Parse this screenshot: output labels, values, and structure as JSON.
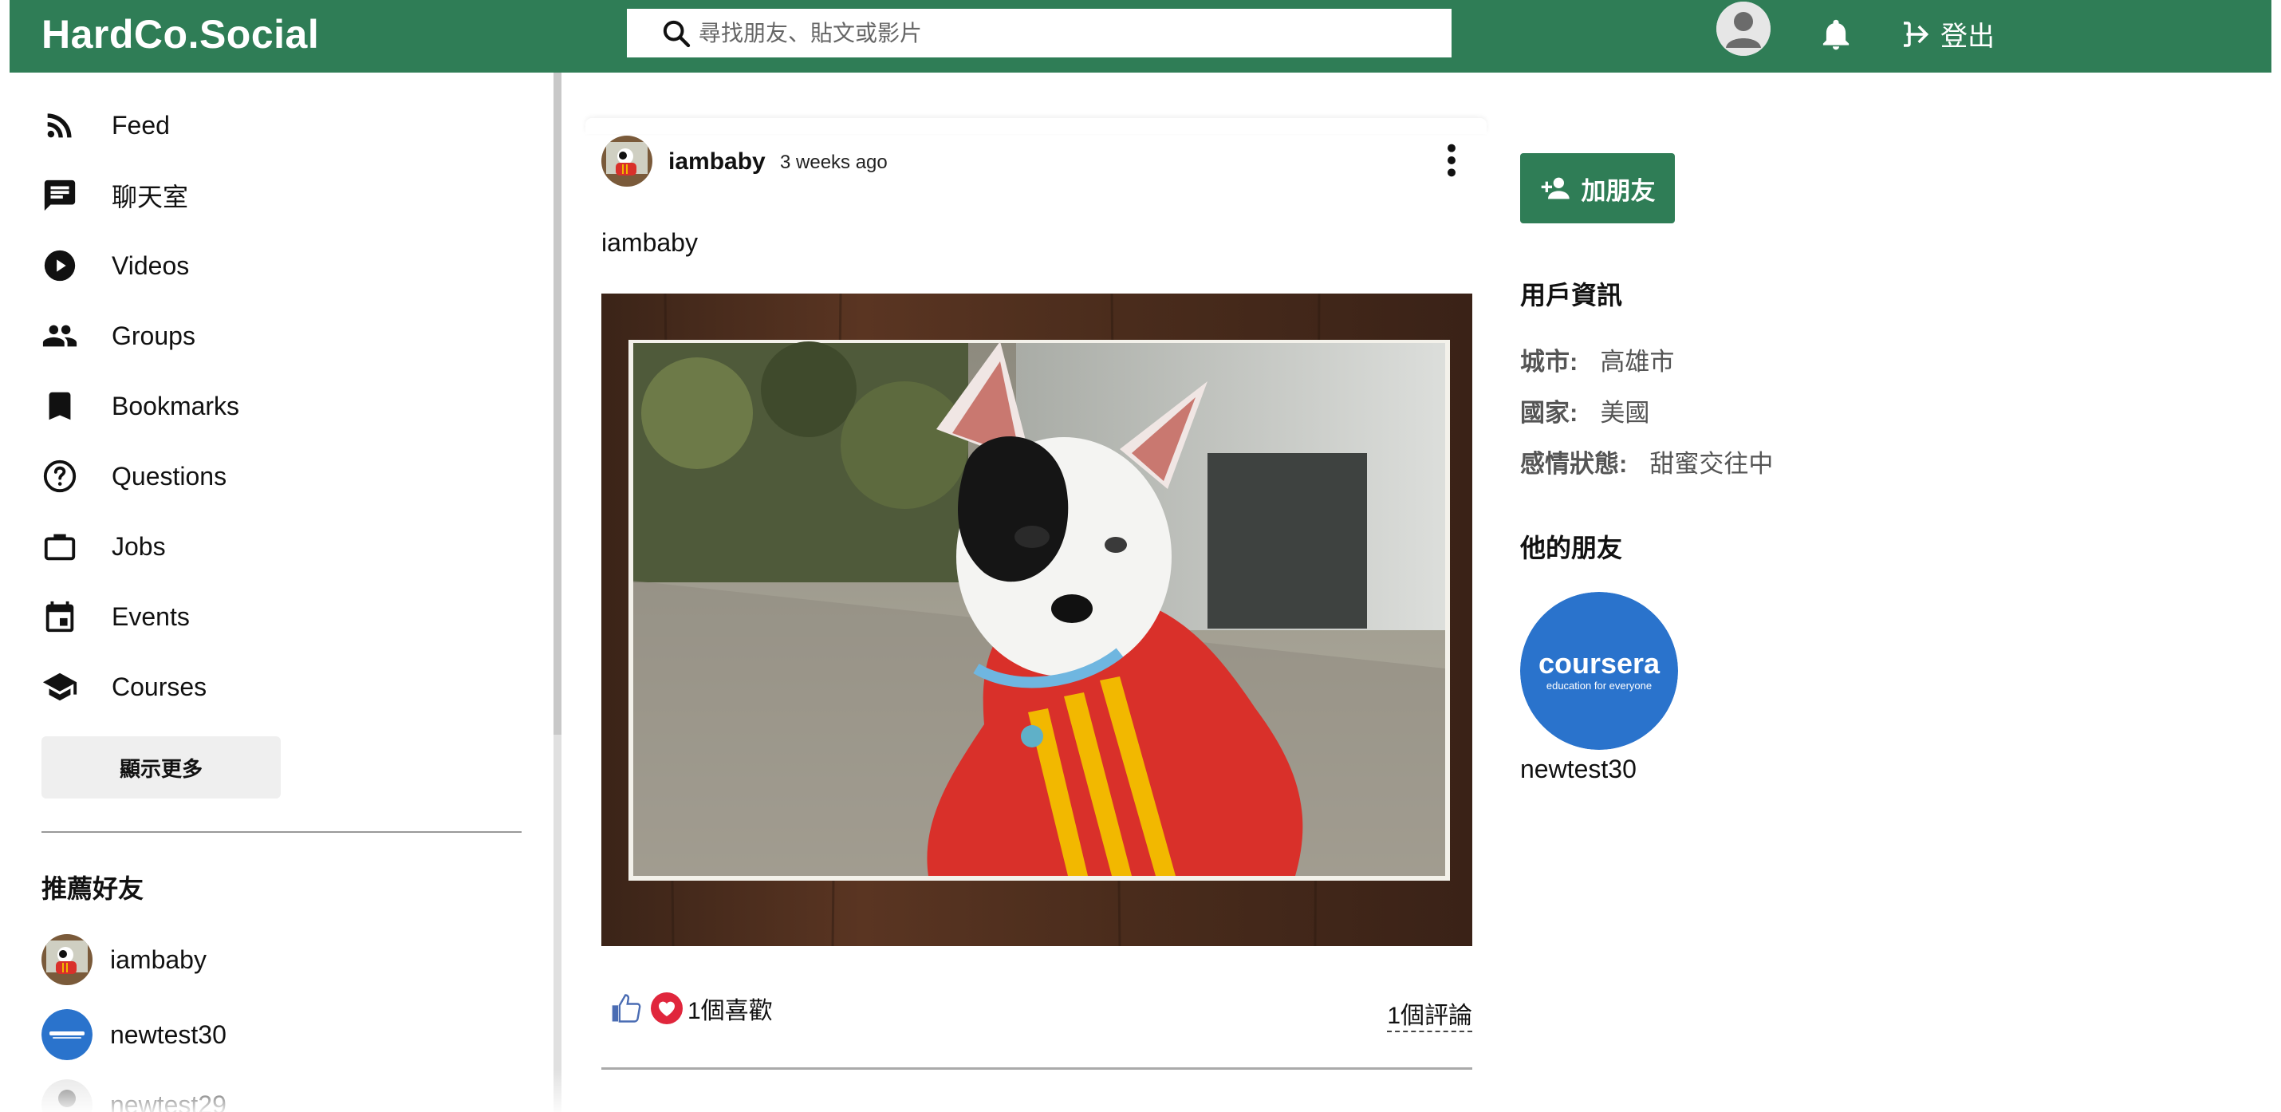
{
  "header": {
    "logo": "HardCo.Social",
    "search_placeholder": "尋找朋友、貼文或影片",
    "logout_label": "登出"
  },
  "sidebar": {
    "nav": [
      {
        "label": "Feed",
        "icon": "rss-icon"
      },
      {
        "label": "聊天室",
        "icon": "chat-icon"
      },
      {
        "label": "Videos",
        "icon": "play-circle-icon"
      },
      {
        "label": "Groups",
        "icon": "group-icon"
      },
      {
        "label": "Bookmarks",
        "icon": "bookmark-icon"
      },
      {
        "label": "Questions",
        "icon": "help-circle-icon"
      },
      {
        "label": "Jobs",
        "icon": "briefcase-icon"
      },
      {
        "label": "Events",
        "icon": "calendar-icon"
      },
      {
        "label": "Courses",
        "icon": "graduation-cap-icon"
      }
    ],
    "more_button": "顯示更多",
    "recommend_title": "推薦好友",
    "recommended": [
      {
        "name": "iambaby"
      },
      {
        "name": "newtest30"
      },
      {
        "name": "newtest29"
      }
    ]
  },
  "post": {
    "author": "iambaby",
    "time": "3 weeks ago",
    "text": "iambaby",
    "likes": "1個喜歡",
    "comments": "1個評論"
  },
  "profile": {
    "add_friend": "加朋友",
    "info_title": "用戶資訊",
    "city_label": "城市:",
    "city": "高雄市",
    "country_label": "國家:",
    "country": "美國",
    "relationship_label": "感情狀態:",
    "relationship": "甜蜜交往中",
    "friends_title": "他的朋友",
    "friends": [
      {
        "name": "newtest30",
        "logo_text": "coursera",
        "logo_sub": "education for everyone"
      }
    ]
  },
  "colors": {
    "brand_green": "#2f7d56",
    "coursera_blue": "#2a73cc",
    "like_red": "#e0263c",
    "like_blue": "#4a6cb3"
  }
}
